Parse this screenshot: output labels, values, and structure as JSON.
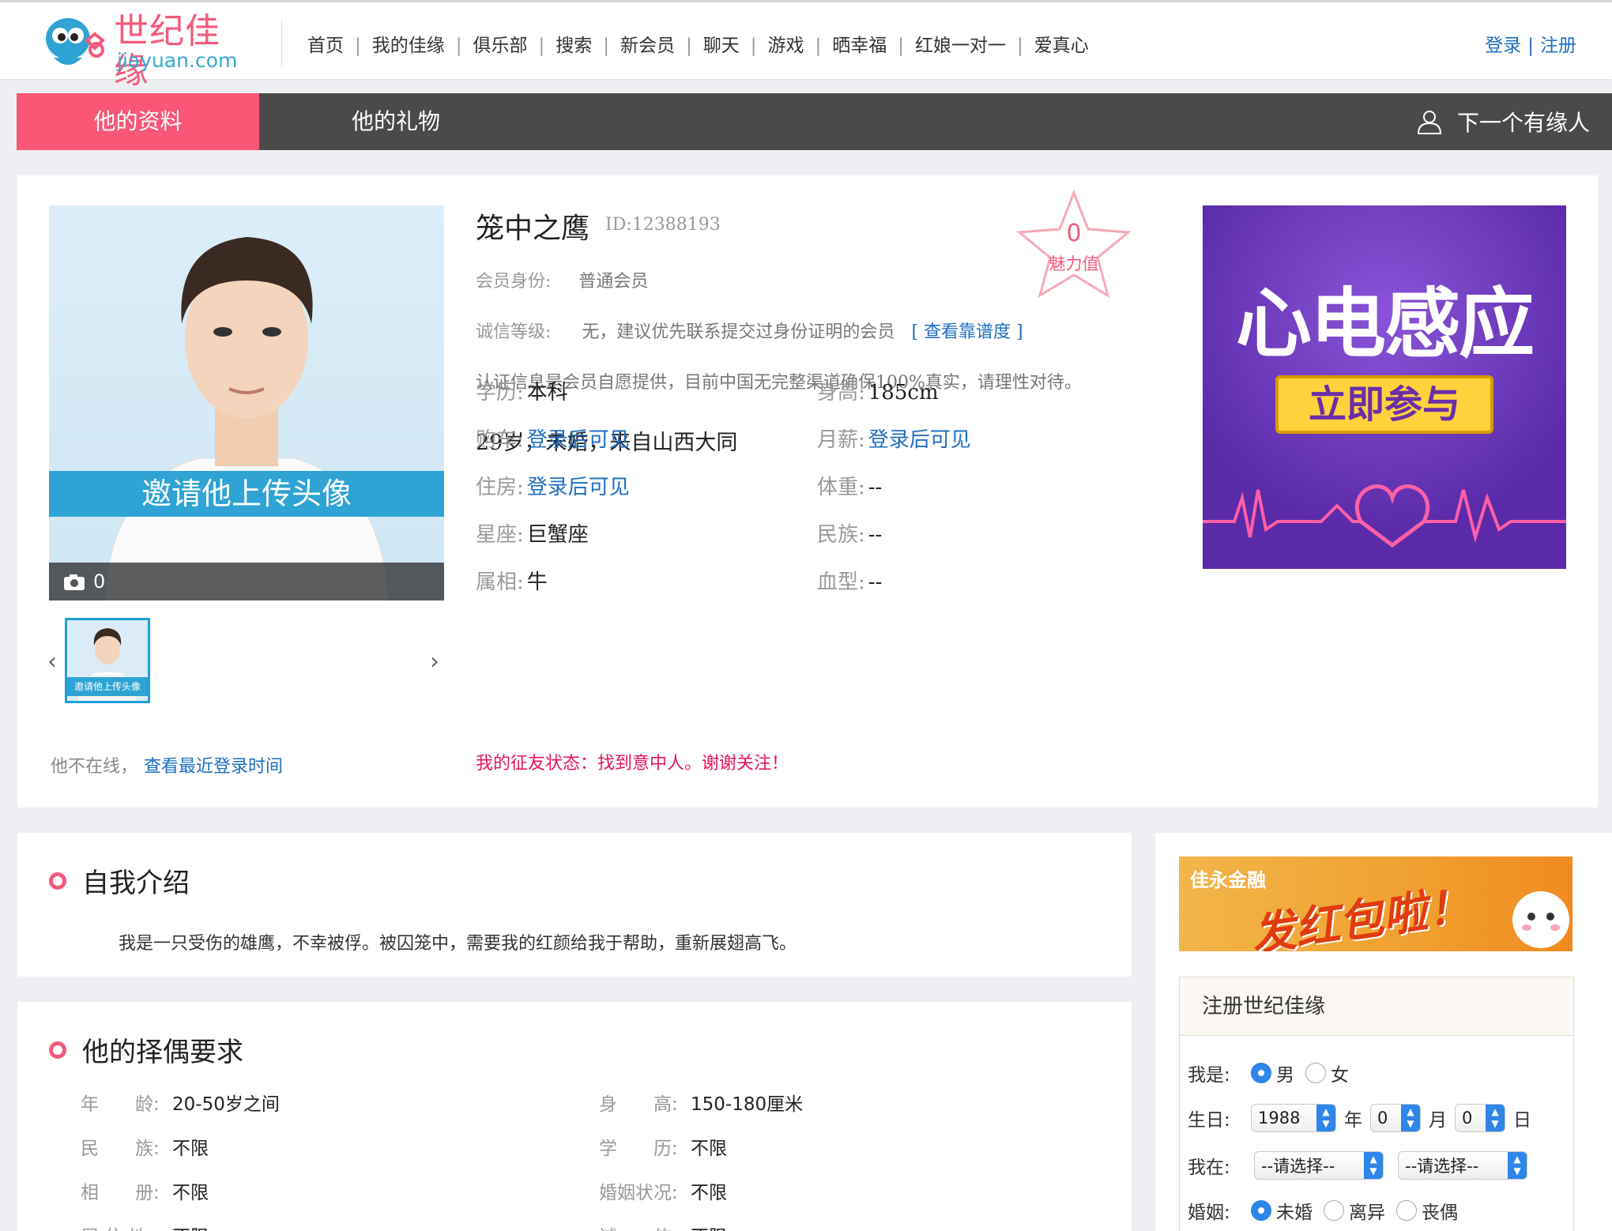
{
  "header": {
    "logo_cn": "世纪佳缘",
    "logo_en": "jiayuan.com",
    "nav": [
      "首页",
      "我的佳缘",
      "俱乐部",
      "搜索",
      "新会员",
      "聊天",
      "游戏",
      "晒幸福",
      "红娘一对一",
      "爱真心"
    ],
    "login": "登录",
    "register": "注册"
  },
  "tabs": {
    "profile": "他的资料",
    "gifts": "他的礼物",
    "next": "下一个有缘人"
  },
  "profile": {
    "invite_upload": "邀请他上传头像",
    "photo_count": "0",
    "thumb_caption": "邀请他上传头像",
    "online_status": "他不在线，",
    "last_login_link": "查看最近登录时间",
    "name": "笼中之鹰",
    "id": "ID:12388193",
    "charm_value": "0",
    "charm_label": "魅力值",
    "membership_label": "会员身份:",
    "membership_value": "普通会员",
    "credit_label": "诚信等级:",
    "credit_value": "无，建议优先联系提交过身份证明的会员",
    "credit_link": "[ 查看靠谱度 ]",
    "disclaimer": "认证信息是会员自愿提供，目前中国无完整渠道确保100%真实，请理性对待。",
    "summary": "29岁，未婚，来自山西大同",
    "fields": [
      {
        "label": "学历:",
        "value": "本科"
      },
      {
        "label": "身高:",
        "value": "185cm"
      },
      {
        "label": "购车:",
        "value": "登录后可见"
      },
      {
        "label": "月薪:",
        "value": "登录后可见"
      },
      {
        "label": "住房:",
        "value": "登录后可见"
      },
      {
        "label": "体重:",
        "value": "--"
      },
      {
        "label": "星座:",
        "value": "巨蟹座"
      },
      {
        "label": "民族:",
        "value": "--"
      },
      {
        "label": "属相:",
        "value": "牛"
      },
      {
        "label": "血型:",
        "value": "--"
      }
    ],
    "dating_status": "我的征友状态：找到意中人。谢谢关注！"
  },
  "ads": {
    "ad1_title": "心电感应",
    "ad1_button": "立即参与",
    "ad2_brand": "佳永金融",
    "ad2_main": "发红包啦！"
  },
  "intro": {
    "title": "自我介绍",
    "text": "我是一只受伤的雄鹰，不幸被俘。被囚笼中，需要我的红颜给我于帮助，重新展翅高飞。"
  },
  "requirements": {
    "title": "他的择偶要求",
    "items": [
      {
        "label": "年　　龄:",
        "value": "20-50岁之间"
      },
      {
        "label": "身　　高:",
        "value": "150-180厘米"
      },
      {
        "label": "民　　族:",
        "value": "不限"
      },
      {
        "label": "学　　历:",
        "value": "不限"
      },
      {
        "label": "相　　册:",
        "value": "不限"
      },
      {
        "label": "婚姻状况:",
        "value": "不限"
      },
      {
        "label": "居  住  地:",
        "value": "不限"
      },
      {
        "label": "诚　　信:",
        "value": "不限"
      }
    ]
  },
  "register": {
    "title": "注册世纪佳缘",
    "gender_label": "我是:",
    "male": "男",
    "female": "女",
    "birthday_label": "生日:",
    "year_value": "1988",
    "year_unit": "年",
    "month_value": "0",
    "month_unit": "月",
    "day_value": "0",
    "day_unit": "日",
    "location_label": "我在:",
    "province_placeholder": "--请选择--",
    "city_placeholder": "--请选择--",
    "marriage_label": "婚姻:",
    "single": "未婚",
    "divorced": "离异",
    "widowed": "丧偶"
  },
  "colors": {
    "accent_pink": "#fa5675",
    "link_blue": "#1f6ec0",
    "tab_bar": "#4a4a4a"
  }
}
